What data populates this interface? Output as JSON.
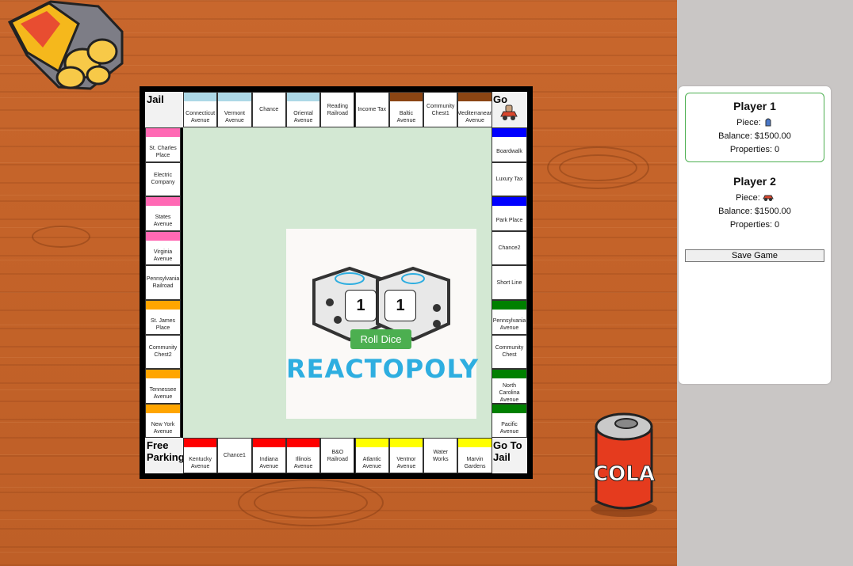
{
  "players": [
    {
      "name": "Player 1",
      "piece_label": "Piece:",
      "piece_icon": "thimble-icon",
      "balance": "Balance: $1500.00",
      "properties": "Properties: 0",
      "active": true
    },
    {
      "name": "Player 2",
      "piece_label": "Piece:",
      "piece_icon": "car-icon",
      "balance": "Balance: $1500.00",
      "properties": "Properties: 0",
      "active": false
    }
  ],
  "save_button": "Save Game",
  "dice": {
    "die1": "1",
    "die2": "1",
    "roll_label": "Roll Dice"
  },
  "logo_text": "REACTOPOLY",
  "corners": {
    "jail": "Jail",
    "go": "Go",
    "free_parking": "Free Parking",
    "go_to_jail": "Go To Jail"
  },
  "top_row": [
    {
      "name": "Connecticut Avenue",
      "color": "#add8e6"
    },
    {
      "name": "Vermont Avenue",
      "color": "#add8e6"
    },
    {
      "name": "Chance",
      "color": null
    },
    {
      "name": "Oriental Avenue",
      "color": "#add8e6"
    },
    {
      "name": "Reading Railroad",
      "color": null
    },
    {
      "name": "Income Tax",
      "color": null
    },
    {
      "name": "Baltic Avenue",
      "color": "#8b4513"
    },
    {
      "name": "Community Chest1",
      "color": null
    },
    {
      "name": "Mediterranean Avenue",
      "color": "#8b4513"
    }
  ],
  "left_col": [
    {
      "name": "St. Charles Place",
      "color": "#ff69b4"
    },
    {
      "name": "Electric Company",
      "color": null
    },
    {
      "name": "States Avenue",
      "color": "#ff69b4"
    },
    {
      "name": "Virginia Avenue",
      "color": "#ff69b4"
    },
    {
      "name": "Pennsylvania Railroad",
      "color": null
    },
    {
      "name": "St. James Place",
      "color": "#ffa500"
    },
    {
      "name": "Community Chest2",
      "color": null
    },
    {
      "name": "Tennessee Avenue",
      "color": "#ffa500"
    },
    {
      "name": "New York Avenue",
      "color": "#ffa500"
    }
  ],
  "right_col": [
    {
      "name": "Boardwalk",
      "color": "#0000ff"
    },
    {
      "name": "Luxury Tax",
      "color": null
    },
    {
      "name": "Park Place",
      "color": "#0000ff"
    },
    {
      "name": "Chance2",
      "color": null
    },
    {
      "name": "Short Line",
      "color": null
    },
    {
      "name": "Pennsylvania Avenue",
      "color": "#008000"
    },
    {
      "name": "Community Chest",
      "color": null
    },
    {
      "name": "North Carolina Avenue",
      "color": "#008000"
    },
    {
      "name": "Pacific Avenue",
      "color": "#008000"
    }
  ],
  "bottom_row": [
    {
      "name": "Kentucky Avenue",
      "color": "#ff0000"
    },
    {
      "name": "Chance1",
      "color": null
    },
    {
      "name": "Indiana Avenue",
      "color": "#ff0000"
    },
    {
      "name": "Illinois Avenue",
      "color": "#ff0000"
    },
    {
      "name": "B&O Railroad",
      "color": null
    },
    {
      "name": "Atlantic Avenue",
      "color": "#ffff00"
    },
    {
      "name": "Ventnor Avenue",
      "color": "#ffff00"
    },
    {
      "name": "Water Works",
      "color": null
    },
    {
      "name": "Marvin Gardens",
      "color": "#ffff00"
    }
  ]
}
